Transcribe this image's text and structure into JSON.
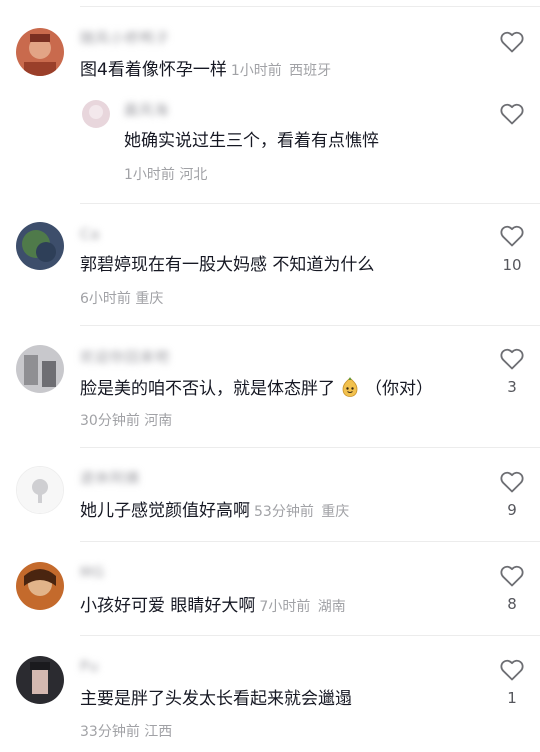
{
  "comments": [
    {
      "username": "随风小桥鸭子",
      "text": "图4看着像怀孕一样",
      "time": "1小时前",
      "location": "西班牙",
      "likes": "",
      "avatar_color": "#c96a4d"
    },
    {
      "username": "晨风海",
      "text": "她确实说过生三个，看着有点憔悴",
      "time": "1小时前",
      "location": "河北",
      "likes": "",
      "avatar_color": "#e8d6dc"
    },
    {
      "username": "Ca",
      "text": "郭碧婷现在有一股大妈感 不知道为什么",
      "time": "6小时前",
      "location": "重庆",
      "likes": "10",
      "avatar_color": "#3d4e6b"
    },
    {
      "username": "欢迎你回来吧",
      "text_before": "脸是美的咱不否认，就是体态胖了",
      "text_after": "（你对）",
      "emoji": "smile-emoji",
      "time": "30分钟前",
      "location": "河南",
      "likes": "3",
      "avatar_color": "#8f8f93"
    },
    {
      "username": "退休阿姨",
      "text": "她儿子感觉颜值好高啊",
      "time": "53分钟前",
      "location": "重庆",
      "likes": "9",
      "avatar_color": "#eeeeee"
    },
    {
      "username": "MG",
      "text": "小孩好可爱 眼睛好大啊",
      "time": "7小时前",
      "location": "湖南",
      "likes": "8",
      "avatar_color": "#c46a2c"
    },
    {
      "username": "Pu",
      "text": "主要是胖了头发太长看起来就会邋遢",
      "time": "33分钟前",
      "location": "江西",
      "likes": "1",
      "avatar_color": "#2b2b30"
    }
  ],
  "icons": {
    "like": "heart-outline-icon"
  },
  "colors": {
    "text": "#161823",
    "meta": "#a1a2a6",
    "count": "#56575d"
  }
}
